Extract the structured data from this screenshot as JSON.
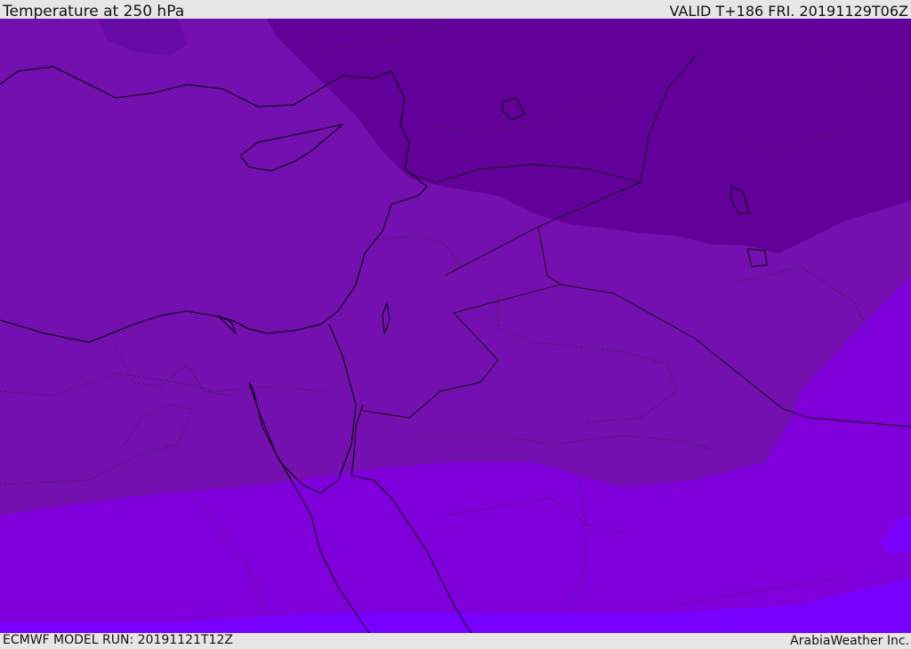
{
  "header": {
    "title": "Temperature at 250 hPa",
    "valid": "VALID T+186 FRI. 20191129T06Z"
  },
  "footer": {
    "model_run": "ECMWF MODEL RUN: 20191121T12Z",
    "credit": "ArabiaWeather Inc."
  },
  "map": {
    "colors": {
      "coldest_band": "#62009a",
      "cold_band": "#7310af",
      "mid_band": "#8000dc",
      "warm_band": "#7800ff",
      "coastline": "#000000",
      "border": "#222222"
    }
  }
}
